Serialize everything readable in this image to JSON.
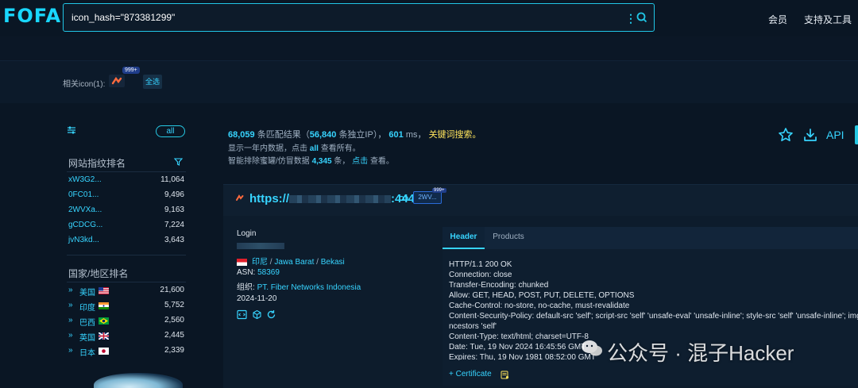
{
  "header": {
    "logo": "FOFA",
    "search_value": "icon_hash=\"873381299\"",
    "nav": [
      "会员",
      "支持及工具"
    ]
  },
  "related": {
    "label": "相关icon(1):",
    "badge": "999+",
    "select_all": "全选"
  },
  "sidebar": {
    "all_pill": "all",
    "fingerprint_title": "网站指纹排名",
    "fingerprints": [
      {
        "name": "xW3G2...",
        "count": "11,064"
      },
      {
        "name": "0FC01...",
        "count": "9,496"
      },
      {
        "name": "2WVXa...",
        "count": "9,163"
      },
      {
        "name": "gCDCG...",
        "count": "7,224"
      },
      {
        "name": "jvN3kd...",
        "count": "3,643"
      }
    ],
    "country_title": "国家/地区排名",
    "countries": [
      {
        "name": "美国",
        "count": "21,600",
        "flag": "us"
      },
      {
        "name": "印度",
        "count": "5,752",
        "flag": "in"
      },
      {
        "name": "巴西",
        "count": "2,560",
        "flag": "br"
      },
      {
        "name": "英国",
        "count": "2,445",
        "flag": "gb"
      },
      {
        "name": "日本",
        "count": "2,339",
        "flag": "jp"
      }
    ]
  },
  "stats": {
    "matches": "68,059",
    "matches_label": "条匹配结果（",
    "unique_ip": "56,840",
    "unique_ip_label": "条独立IP），",
    "ms": "601",
    "ms_label": "ms，",
    "keyword_search": "关键词搜索。",
    "line2_prefix": "显示一年内数据，点击",
    "line2_link": "all",
    "line2_suffix": "查看所有。",
    "line3_prefix": "智能排除蜜罐/仿冒数据",
    "line3_count": "4,345",
    "line3_mid": "条，",
    "line3_link": "点击",
    "line3_suffix": "查看。",
    "api_label": "API"
  },
  "result": {
    "host_prefix": "https://",
    "host_suffix": ":4443",
    "fp_tag": "2WV...",
    "fp_badge": "999+",
    "title": "Login",
    "country": "印尼",
    "region": "Jawa Barat",
    "city": "Bekasi",
    "asn_label": "ASN:",
    "asn": "58369",
    "org_label": "组织:",
    "org": "PT. Fiber Networks Indonesia",
    "date": "2024-11-20",
    "tabs": [
      "Header",
      "Products"
    ],
    "header_lines": [
      "HTTP/1.1 200 OK",
      "Connection: close",
      "Transfer-Encoding: chunked",
      "Allow: GET, HEAD, POST, PUT, DELETE, OPTIONS",
      "Cache-Control: no-store, no-cache, must-revalidate",
      "Content-Security-Policy: default-src 'self'; script-src 'self' 'unsafe-eval' 'unsafe-inline'; style-src 'self' 'unsafe-inline'; img-src",
      "ncestors 'self'",
      "Content-Type: text/html; charset=UTF-8",
      "Date: Tue, 19 Nov 2024 16:45:56 GMT",
      "Expires: Thu, 19 Nov 1981 08:52:00 GMT"
    ],
    "certificate": "+ Certificate"
  },
  "watermark": "公众号 · 混子Hacker"
}
